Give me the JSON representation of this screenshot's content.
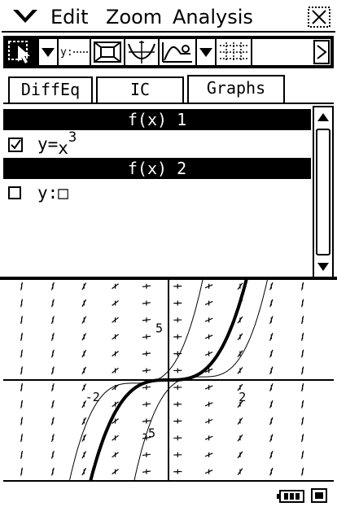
{
  "menu": {
    "items": [
      "Edit",
      "Zoom",
      "Analysis"
    ],
    "menu_icon": "down-chevron-icon",
    "close_icon": "close-x-icon"
  },
  "toolbar": {
    "tools": [
      "select-arrow-icon",
      "dropdown-arrow-icon",
      "direction-field-icon",
      "zoom-box-icon",
      "trace-icon",
      "sketch-icon",
      "dropdown-arrow-icon",
      "grid-icon",
      "more-arrow-icon"
    ],
    "direction_label": "y⁄⁄⋯"
  },
  "tabs": [
    {
      "label": "DiffEq",
      "active": false
    },
    {
      "label": "IC",
      "active": false
    },
    {
      "label": "Graphs",
      "active": true
    }
  ],
  "list": {
    "headers": [
      "f(x) 1",
      "f(x) 2"
    ],
    "rows": [
      {
        "checked": true,
        "prefix": "y=",
        "base": "x",
        "exp": "3"
      },
      {
        "checked": false,
        "prefix": "y:",
        "box": "□"
      }
    ]
  },
  "graph": {
    "tick_labels": {
      "y_pos": "5",
      "y_neg": "-5",
      "x_neg": "-2",
      "x_pos": "2"
    },
    "function": "y=x^3",
    "x_range": [
      -4.5,
      4.5
    ],
    "y_range": [
      -9.5,
      9.5
    ]
  }
}
